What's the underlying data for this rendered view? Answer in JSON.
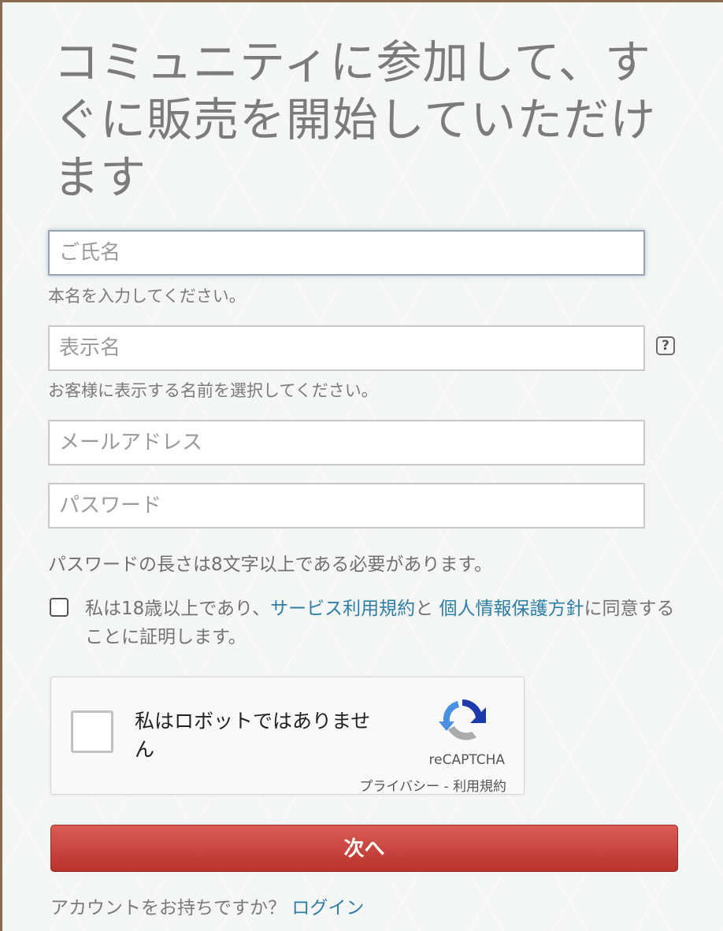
{
  "title": "コミュニティに参加して、すぐに販売を開始していただけます",
  "fields": {
    "full_name": {
      "placeholder": "ご氏名",
      "hint": "本名を入力してください。"
    },
    "display_name": {
      "placeholder": "表示名",
      "hint": "お客様に表示する名前を選択してください。",
      "help_icon": "?"
    },
    "email": {
      "placeholder": "メールアドレス"
    },
    "password": {
      "placeholder": "パスワード",
      "note": "パスワードの長さは8文字以上である必要があります。"
    }
  },
  "agreement": {
    "prefix": "私は18歳以上であり、",
    "terms_link": "サービス利用規約",
    "middle": "と ",
    "privacy_link": "個人情報保護方針",
    "suffix": "に同意することに証明します。"
  },
  "recaptcha": {
    "label": "私はロボットではありません",
    "brand": "reCAPTCHA",
    "links": "プライバシー - 利用規約",
    "icon": "recaptcha-logo"
  },
  "next_button": "次へ",
  "account": {
    "question": "アカウントをお持ちですか？ ",
    "login_link": "ログイン"
  },
  "colors": {
    "primary_button": "#c4433c",
    "link": "#2e7ea8",
    "title": "#7b7b7b"
  }
}
